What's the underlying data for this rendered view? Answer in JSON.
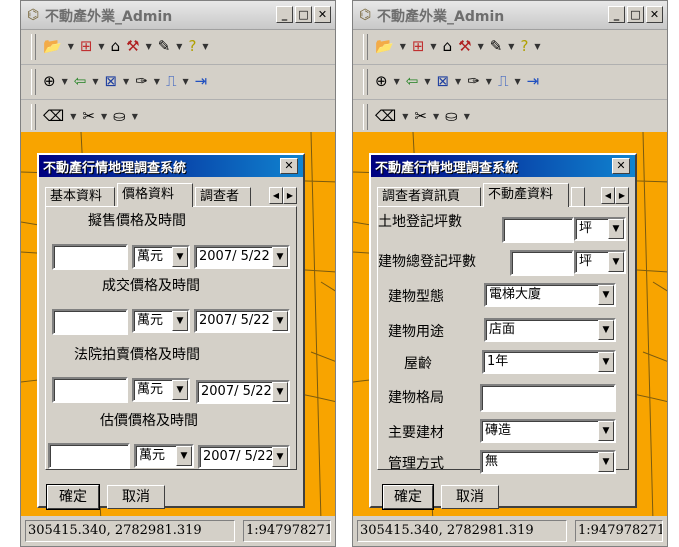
{
  "window_title": "不動產外業_Admin",
  "dialog_title": "不動產行情地理調查系統",
  "status": {
    "coordinates": "305415.340, 2782981.319",
    "scale": "1:947978271"
  },
  "buttons": {
    "ok": "確定",
    "cancel": "取消"
  },
  "left_panel": {
    "tabs": [
      "基本資料",
      "價格資料",
      "調查者"
    ],
    "active_tab": "價格資料",
    "sections": [
      {
        "label": "擬售價格及時間",
        "unit": "萬元",
        "date": "2007/ 5/22"
      },
      {
        "label": "成交價格及時間",
        "unit": "萬元",
        "date": "2007/ 5/22"
      },
      {
        "label": "法院拍賣價格及時間",
        "unit": "萬元",
        "date": "2007/ 5/22"
      },
      {
        "label": "估價價格及時間",
        "unit": "萬元",
        "date": "2007/ 5/22"
      }
    ]
  },
  "right_panel": {
    "tabs": [
      "調查者資訊頁",
      "不動產資料"
    ],
    "active_tab": "不動產資料",
    "land_area": {
      "label": "土地登記坪數",
      "unit": "坪"
    },
    "building_area": {
      "label": "建物總登記坪數",
      "unit": "坪"
    },
    "fields": [
      {
        "label": "建物型態",
        "value": "電梯大廈"
      },
      {
        "label": "建物用途",
        "value": "店面"
      },
      {
        "label": "屋齡",
        "value": "1年"
      },
      {
        "label": "建物格局",
        "value": ""
      },
      {
        "label": "主要建材",
        "value": "磚造"
      },
      {
        "label": "管理方式",
        "value": "無"
      }
    ]
  },
  "colors": {
    "map": "#f8a400",
    "titlebar": "#000080"
  },
  "icons": [
    "open-folder-icon",
    "add-layer-icon",
    "hammer-icon",
    "ruler-icon",
    "help-icon",
    "zoom-icon",
    "back-icon",
    "zoom-extent-icon",
    "measure-icon",
    "chart-icon",
    "export-icon",
    "eraser-icon",
    "scissors-icon",
    "bucket-icon"
  ]
}
